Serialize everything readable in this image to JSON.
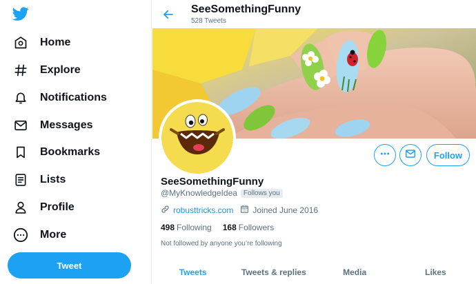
{
  "colors": {
    "accent": "#1da1f2",
    "link": "#1b95e0",
    "text_primary": "#0f1419",
    "text_secondary": "#5b7083"
  },
  "sidebar": {
    "logo_icon": "twitter-bird-icon",
    "items": [
      {
        "label": "Home",
        "icon": "home-icon"
      },
      {
        "label": "Explore",
        "icon": "hashtag-icon"
      },
      {
        "label": "Notifications",
        "icon": "bell-icon"
      },
      {
        "label": "Messages",
        "icon": "envelope-icon"
      },
      {
        "label": "Bookmarks",
        "icon": "bookmark-icon"
      },
      {
        "label": "Lists",
        "icon": "list-icon"
      },
      {
        "label": "Profile",
        "icon": "person-icon"
      },
      {
        "label": "More",
        "icon": "more-circle-icon"
      }
    ],
    "tweet_button": "Tweet"
  },
  "header": {
    "back_icon": "back-arrow-icon",
    "title": "SeeSomethingFunny",
    "tweet_count": "528 Tweets"
  },
  "profile": {
    "display_name": "SeeSomethingFunny",
    "handle": "@MyKnowledgeIdea",
    "follows_you": "Follows you",
    "website": "robusttricks.com",
    "joined": "Joined June 2016",
    "following_count": "498",
    "following_label": "Following",
    "followers_count": "168",
    "followers_label": "Followers",
    "not_followed_note": "Not followed by anyone you’re following",
    "follow_button": "Follow"
  },
  "tabs": [
    {
      "label": "Tweets",
      "active": true
    },
    {
      "label": "Tweets & replies",
      "active": false
    },
    {
      "label": "Media",
      "active": false
    },
    {
      "label": "Likes",
      "active": false
    }
  ]
}
